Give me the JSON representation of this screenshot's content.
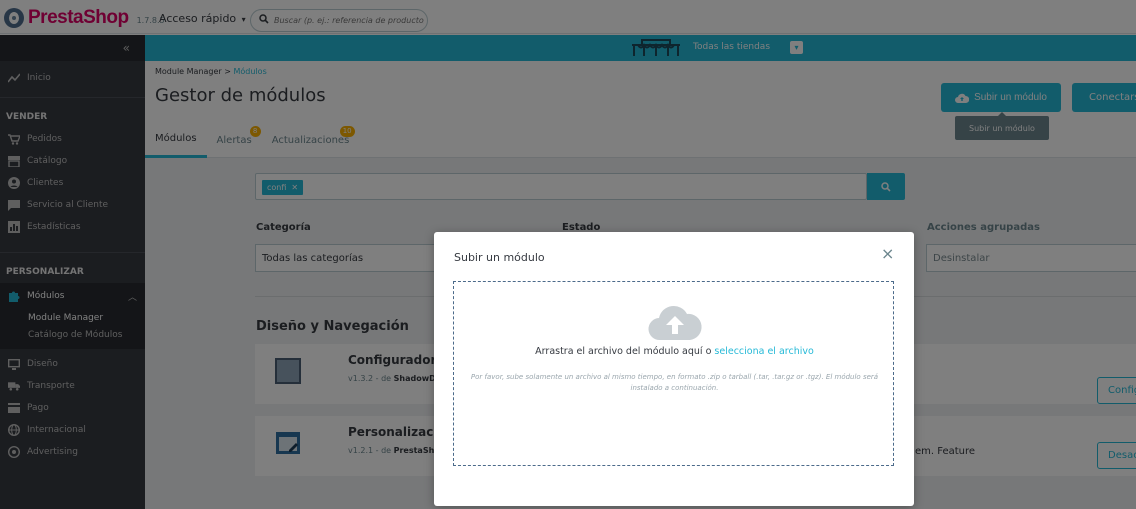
{
  "topbar": {
    "logo_text": "PrestaShop",
    "version": "1.7.8.5",
    "quick_access": "Acceso rápido",
    "search_placeholder": "Buscar (p. ej.: referencia de producto,"
  },
  "shopbar": {
    "label": "Todas las tiendas"
  },
  "sidebar": {
    "items": [
      {
        "label": "Inicio",
        "icon": "trend-icon"
      },
      {
        "section": "VENDER"
      },
      {
        "label": "Pedidos",
        "icon": "cart-icon"
      },
      {
        "label": "Catálogo",
        "icon": "store-icon"
      },
      {
        "label": "Clientes",
        "icon": "user-icon"
      },
      {
        "label": "Servicio al Cliente",
        "icon": "chat-icon"
      },
      {
        "label": "Estadísticas",
        "icon": "stats-icon"
      },
      {
        "section": "PERSONALIZAR"
      },
      {
        "label": "Módulos",
        "icon": "puzzle-icon"
      },
      {
        "label": "Diseño",
        "icon": "monitor-icon"
      },
      {
        "label": "Transporte",
        "icon": "truck-icon"
      },
      {
        "label": "Pago",
        "icon": "card-icon"
      },
      {
        "label": "Internacional",
        "icon": "globe-icon"
      },
      {
        "label": "Advertising",
        "icon": "advertising-icon"
      }
    ],
    "submenu": [
      "Module Manager",
      "Catálogo de Módulos"
    ]
  },
  "header": {
    "breadcrumb_root": "Module Manager",
    "breadcrumb_sep": ">",
    "breadcrumb_current": "Módulos",
    "title": "Gestor de módulos",
    "upload_button": "Subir un módulo",
    "connect_button": "Conectarse",
    "tooltip": "Subir un módulo",
    "tabs": [
      {
        "label": "Módulos"
      },
      {
        "label": "Alertas",
        "badge": "8"
      },
      {
        "label": "Actualizaciones",
        "badge": "10"
      }
    ]
  },
  "filters": {
    "tag": "confi",
    "category_label": "Categoría",
    "category_value": "Todas las categorías",
    "status_label": "Estado",
    "bulk_label": "Acciones agrupadas",
    "bulk_value": "Desinstalar"
  },
  "section": {
    "title": "Diseño y Navegación",
    "modules": [
      {
        "name": "Configurador d",
        "version": "v1.3.2 - de",
        "author": "ShadowDi",
        "description": "",
        "button": "Configurar"
      },
      {
        "name": "Personalización",
        "version": "v1.2.1 - de",
        "author": "PrestaSho",
        "description": "em. Feature",
        "button": "Desactivar"
      }
    ]
  },
  "modal": {
    "title": "Subir un módulo",
    "close": "×",
    "drop_text": "Arrastra el archivo del módulo aquí o",
    "drop_link": "selecciona el archivo",
    "hint": "Por favor, sube solamente un archivo al mismo tiempo, en formato .zip o tarball (.tar, .tar.gz or .tgz). El módulo será instalado a continuación."
  },
  "colors": {
    "accent": "#25b9d7",
    "sidebar": "#363a41",
    "brand": "#df0067"
  }
}
